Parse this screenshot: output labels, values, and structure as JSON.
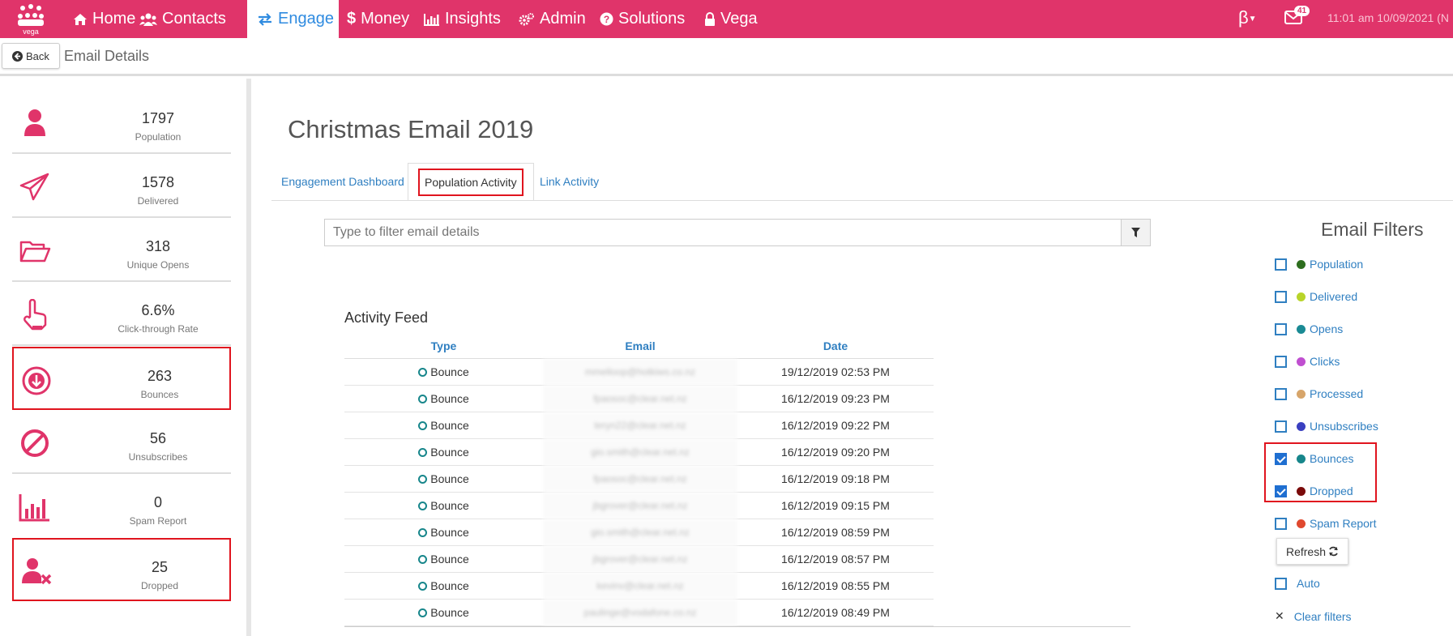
{
  "nav": {
    "items": [
      {
        "label": "Home",
        "icon": "home-icon"
      },
      {
        "label": "Contacts",
        "icon": "users-icon"
      },
      {
        "label": "Engage",
        "icon": "exchange-icon"
      },
      {
        "label": "Money",
        "icon": "dollar-icon"
      },
      {
        "label": "Insights",
        "icon": "bar-chart-icon"
      },
      {
        "label": "Admin",
        "icon": "gears-icon"
      },
      {
        "label": "Solutions",
        "icon": "question-circle-icon"
      },
      {
        "label": "Vega",
        "icon": "lock-icon"
      }
    ],
    "active": "Engage",
    "logo_text": "vega",
    "beta": "β",
    "mail_count": "41",
    "clock": "11:01 am 10/09/2021 (N"
  },
  "subheader": {
    "back_label": "Back",
    "title": "Email Details"
  },
  "stats": [
    {
      "value": "1797",
      "label": "Population",
      "icon": "user-icon"
    },
    {
      "value": "1578",
      "label": "Delivered",
      "icon": "paper-plane-icon"
    },
    {
      "value": "318",
      "label": "Unique Opens",
      "icon": "folder-open-icon"
    },
    {
      "value": "6.6%",
      "label": "Click-through Rate",
      "icon": "hand-pointer-icon"
    },
    {
      "value": "263",
      "label": "Bounces",
      "icon": "arrow-circle-down-icon"
    },
    {
      "value": "56",
      "label": "Unsubscribes",
      "icon": "ban-icon"
    },
    {
      "value": "0",
      "label": "Spam Report",
      "icon": "bar-chart-icon"
    },
    {
      "value": "25",
      "label": "Dropped",
      "icon": "user-times-icon"
    }
  ],
  "main": {
    "title": "Christmas Email 2019",
    "tabs": [
      "Engagement Dashboard",
      "Population Activity",
      "Link Activity"
    ],
    "active_tab": "Population Activity",
    "filter_placeholder": "Type to filter email details"
  },
  "feed": {
    "title": "Activity Feed",
    "columns": [
      "Type",
      "Email",
      "Date"
    ],
    "rows": [
      {
        "type": "Bounce",
        "email": "mmelloop@hotkiws.co.nz",
        "date": "19/12/2019 02:53 PM"
      },
      {
        "type": "Bounce",
        "email": "fpaosoc@clear.net.nz",
        "date": "16/12/2019 09:23 PM"
      },
      {
        "type": "Bounce",
        "email": "teryn22@clear.net.nz",
        "date": "16/12/2019 09:22 PM"
      },
      {
        "type": "Bounce",
        "email": "gio.smith@clear.net.nz",
        "date": "16/12/2019 09:20 PM"
      },
      {
        "type": "Bounce",
        "email": "fpaosoc@clear.net.nz",
        "date": "16/12/2019 09:18 PM"
      },
      {
        "type": "Bounce",
        "email": "jbgrover@clear.net.nz",
        "date": "16/12/2019 09:15 PM"
      },
      {
        "type": "Bounce",
        "email": "gio.smith@clear.net.nz",
        "date": "16/12/2019 08:59 PM"
      },
      {
        "type": "Bounce",
        "email": "jbgrover@clear.net.nz",
        "date": "16/12/2019 08:57 PM"
      },
      {
        "type": "Bounce",
        "email": "kevinv@clear.net.nz",
        "date": "16/12/2019 08:55 PM"
      },
      {
        "type": "Bounce",
        "email": "paulinge@vodafone.co.nz",
        "date": "16/12/2019 08:49 PM"
      }
    ]
  },
  "email_filters": {
    "title": "Email Filters",
    "items": [
      {
        "label": "Population",
        "color": "#2e6e1e",
        "checked": false
      },
      {
        "label": "Delivered",
        "color": "#b8d42a",
        "checked": false
      },
      {
        "label": "Opens",
        "color": "#1a8a94",
        "checked": false
      },
      {
        "label": "Clicks",
        "color": "#c04fd0",
        "checked": false
      },
      {
        "label": "Processed",
        "color": "#d7a56a",
        "checked": false
      },
      {
        "label": "Unsubscribes",
        "color": "#3a3fc0",
        "checked": false
      },
      {
        "label": "Bounces",
        "color": "#17868b",
        "checked": true
      },
      {
        "label": "Dropped",
        "color": "#7a0a0a",
        "checked": true
      },
      {
        "label": "Spam Report",
        "color": "#e0492f",
        "checked": false
      }
    ],
    "refresh_label": "Refresh",
    "auto_label": "Auto",
    "clear_label": "Clear filters"
  },
  "colors": {
    "brand": "#e0346a",
    "link": "#2f7fc1",
    "highlight": "#e0141e"
  }
}
